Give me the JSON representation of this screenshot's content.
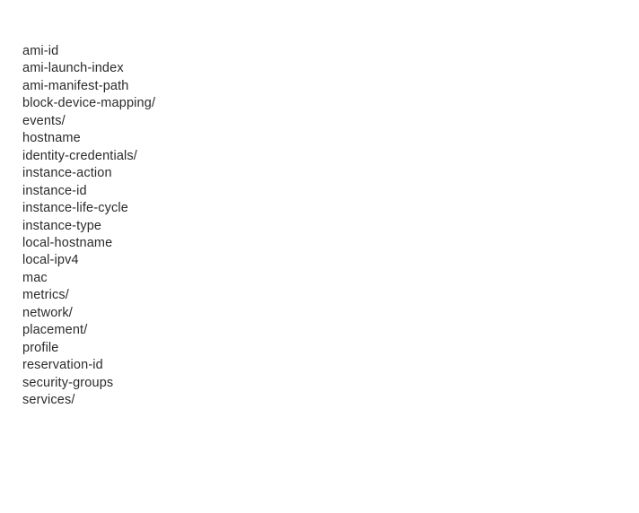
{
  "page": {
    "background_color": "#ffffff",
    "text_color": "#2b2b2b"
  },
  "metadata_listing": {
    "entries": [
      {
        "name": "ami-id"
      },
      {
        "name": "ami-launch-index"
      },
      {
        "name": "ami-manifest-path"
      },
      {
        "name": "block-device-mapping/"
      },
      {
        "name": "events/"
      },
      {
        "name": "hostname"
      },
      {
        "name": "identity-credentials/"
      },
      {
        "name": "instance-action"
      },
      {
        "name": "instance-id"
      },
      {
        "name": "instance-life-cycle"
      },
      {
        "name": "instance-type"
      },
      {
        "name": "local-hostname"
      },
      {
        "name": "local-ipv4"
      },
      {
        "name": "mac"
      },
      {
        "name": "metrics/"
      },
      {
        "name": "network/"
      },
      {
        "name": "placement/"
      },
      {
        "name": "profile"
      },
      {
        "name": "reservation-id"
      },
      {
        "name": "security-groups"
      },
      {
        "name": "services/"
      }
    ]
  }
}
